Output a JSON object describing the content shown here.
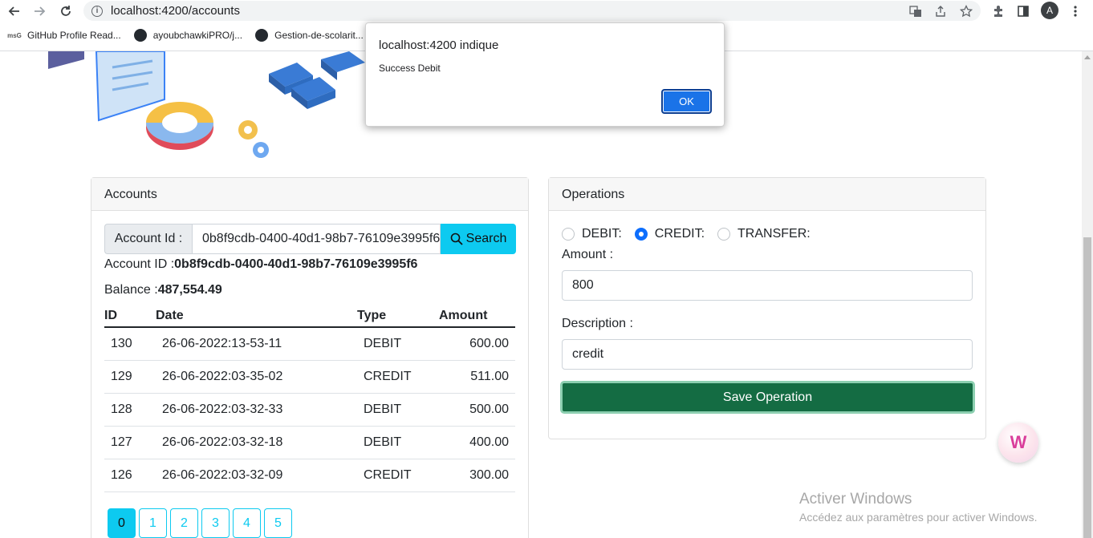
{
  "browser": {
    "url": "localhost:4200/accounts",
    "avatar_letter": "A",
    "bookmarks": [
      {
        "label": "GitHub Profile Read..."
      },
      {
        "label": "ayoubchawkiPRO/j..."
      },
      {
        "label": "Gestion-de-scolarit..."
      }
    ]
  },
  "dialog": {
    "title": "localhost:4200 indique",
    "message": "Success Debit",
    "ok_label": "OK"
  },
  "accounts": {
    "header": "Accounts",
    "account_id_label": "Account Id :",
    "account_id_value": "0b8f9cdb-0400-40d1-98b7-76109e3995f6",
    "search_label": "Search",
    "account_id_line_label": "Account ID :",
    "account_id_line_value": "0b8f9cdb-0400-40d1-98b7-76109e3995f6",
    "balance_label": "Balance :",
    "balance_value": "487,554.49",
    "columns": [
      "ID",
      "Date",
      "Type",
      "Amount"
    ],
    "rows": [
      {
        "id": "130",
        "date": "26-06-2022:13-53-11",
        "type": "DEBIT",
        "amount": "600.00"
      },
      {
        "id": "129",
        "date": "26-06-2022:03-35-02",
        "type": "CREDIT",
        "amount": "511.00"
      },
      {
        "id": "128",
        "date": "26-06-2022:03-32-33",
        "type": "DEBIT",
        "amount": "500.00"
      },
      {
        "id": "127",
        "date": "26-06-2022:03-32-18",
        "type": "DEBIT",
        "amount": "400.00"
      },
      {
        "id": "126",
        "date": "26-06-2022:03-32-09",
        "type": "CREDIT",
        "amount": "300.00"
      }
    ],
    "pages": [
      "0",
      "1",
      "2",
      "3",
      "4",
      "5"
    ],
    "active_page": "0"
  },
  "operations": {
    "header": "Operations",
    "radio_options": [
      "DEBIT:",
      "CREDIT:",
      "TRANSFER:"
    ],
    "selected": "CREDIT:",
    "amount_label": "Amount :",
    "amount_value": "800",
    "description_label": "Description :",
    "description_value": "credit",
    "save_label": "Save Operation"
  },
  "watermark": {
    "line1": "Activer Windows",
    "line2": "Accédez aux paramètres pour activer Windows."
  },
  "colors": {
    "info": "#0dcaf0",
    "primary": "#0d6efd",
    "success": "#146c43"
  }
}
